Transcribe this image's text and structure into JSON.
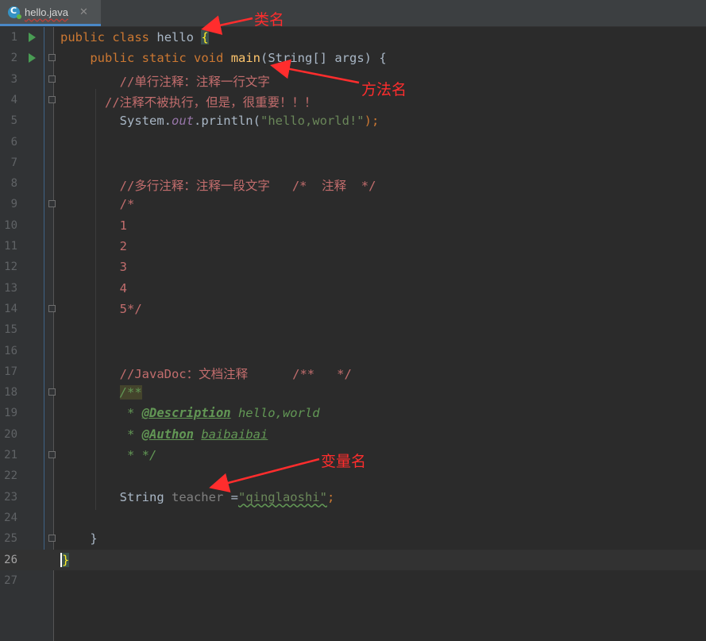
{
  "tab": {
    "label": "hello.java",
    "close": "✕",
    "icon": "java-class-icon"
  },
  "lines": [
    {
      "n": "1"
    },
    {
      "n": "2"
    },
    {
      "n": "3"
    },
    {
      "n": "4"
    },
    {
      "n": "5"
    },
    {
      "n": "6"
    },
    {
      "n": "7"
    },
    {
      "n": "8"
    },
    {
      "n": "9"
    },
    {
      "n": "10"
    },
    {
      "n": "11"
    },
    {
      "n": "12"
    },
    {
      "n": "13"
    },
    {
      "n": "14"
    },
    {
      "n": "15"
    },
    {
      "n": "16"
    },
    {
      "n": "17"
    },
    {
      "n": "18"
    },
    {
      "n": "19"
    },
    {
      "n": "20"
    },
    {
      "n": "21"
    },
    {
      "n": "22"
    },
    {
      "n": "23"
    },
    {
      "n": "24"
    },
    {
      "n": "25"
    },
    {
      "n": "26"
    },
    {
      "n": "27"
    }
  ],
  "code": {
    "l1": {
      "kw1": "public",
      "kw2": "class",
      "name": "hello",
      "brace": "{"
    },
    "l2": {
      "kw1": "public",
      "kw2": "static",
      "kw3": "void",
      "method": "main",
      "params": "(String[] args) {"
    },
    "l3": "//单行注释：注释一行文字",
    "l4": "//注释不被执行，但是，很重要！！！",
    "l5": {
      "a": "System.",
      "b": "out",
      "c": ".println(",
      "d": "\"hello,world!\"",
      "e": ");"
    },
    "l8": "//多行注释：注释一段文字   /*  注释  */",
    "l9": "/*",
    "l10": "1",
    "l11": "2",
    "l12": "3",
    "l13": "4",
    "l14": "5*/",
    "l17": "//JavaDoc：文档注释      /**   */",
    "l18": "/**",
    "l19": {
      "star": " * ",
      "tag": "@Description",
      "val": " hello,world"
    },
    "l20": {
      "star": " * ",
      "tag": "@Authon",
      "sp": " ",
      "val": "baibaibai"
    },
    "l21": " * */",
    "l23": {
      "type": "String ",
      "var": "teacher",
      "eq": " =",
      "str": "\"qinglaoshi\"",
      "semi": ";"
    },
    "l25": "}",
    "l26": "}"
  },
  "annotations": {
    "class_name": "类名",
    "method_name": "方法名",
    "variable_name": "变量名"
  },
  "colors": {
    "background": "#2b2b2b",
    "keyword": "#cc7832",
    "string": "#6a8759",
    "method": "#ffc66d",
    "annotation": "#ff2d2d"
  }
}
